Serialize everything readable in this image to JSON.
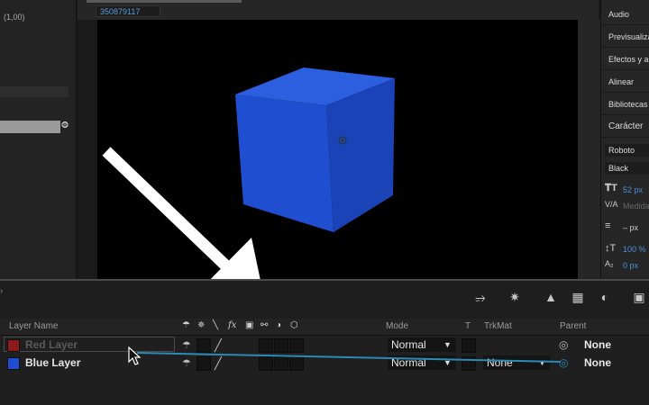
{
  "left_panel": {
    "coords_text": "(1,00)",
    "hierarchy_icon": "hierarchy-icon"
  },
  "viewer": {
    "timecode": "350879117",
    "cube_color": "#1f4fd0",
    "background": "#000000"
  },
  "right_panel": {
    "items": [
      "Audio",
      "Previsualiza",
      "Efectos y a",
      "Alinear",
      "Bibliotecas",
      "Carácter"
    ],
    "font_family": "Roboto",
    "font_style": "Black",
    "font_size": "52 px",
    "kerning_label": "Medidas",
    "leading": "– px",
    "vertical_scale": "100 %",
    "baseline_shift": "0 px"
  },
  "timeline": {
    "headers": {
      "layer_name": "Layer Name",
      "mode": "Mode",
      "t": "T",
      "trkmat": "TrkMat",
      "parent": "Parent"
    },
    "layers": [
      {
        "name": "Red Layer",
        "color": "#8c1a1a",
        "name_color": "#5a5a5a",
        "mode": "Normal",
        "trkmat": "",
        "parent": "None"
      },
      {
        "name": "Blue Layer",
        "color": "#1f4fd0",
        "name_color": "#e6e6e6",
        "mode": "Normal",
        "trkmat": "None",
        "parent": "None"
      }
    ],
    "accent": "#2a8bb8"
  }
}
